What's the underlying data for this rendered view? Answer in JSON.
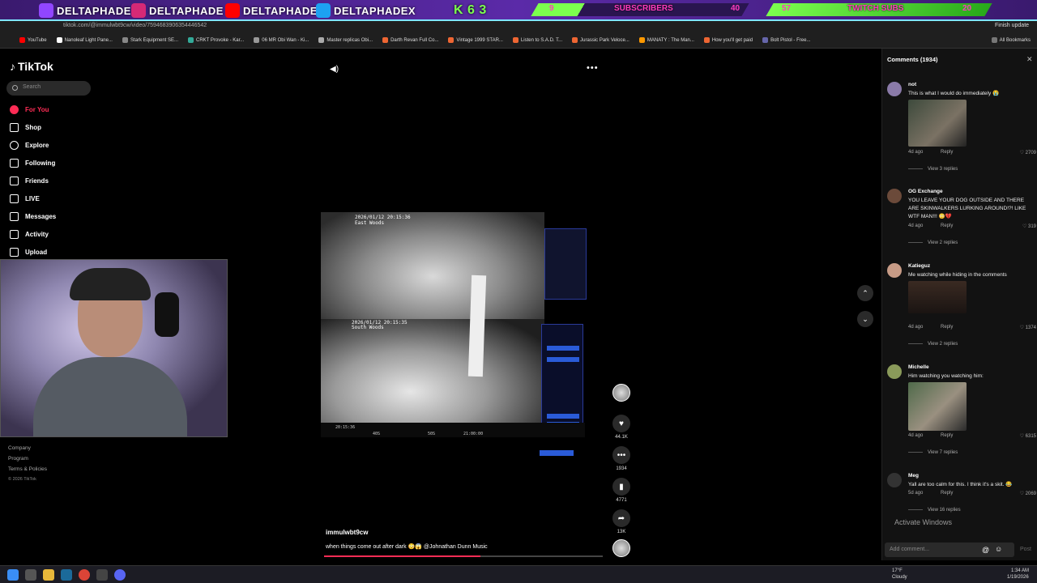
{
  "overlay": {
    "handles": [
      "DELTAPHADE",
      "DELTAPHADE",
      "DELTAPHADE",
      "DELTAPHADEX"
    ],
    "goal_letters": "K 6 3",
    "subs_bar": {
      "current": "9",
      "label": "SUBSCRIBERS",
      "goal": "40"
    },
    "twitch_bar": {
      "current": "57",
      "label": "TWITCH SUBS",
      "goal": "20"
    }
  },
  "browser": {
    "url": "tiktok.com/@immulwbt9cw/video/7594683906354446542",
    "update_label": "Finish update",
    "bookmarks": [
      "YouTube",
      "Nanoleaf Light Pane...",
      "Stark Equipment SE...",
      "CRKT Provoke - Kar...",
      "06 MR Obi Wan - Ki...",
      "Master replicas Obi...",
      "Darth Revan Full Co...",
      "Vintage 1999 STAR...",
      "Listen to S.A.D. T...",
      "Jurassic Park Veloce...",
      "MANATY : The Man...",
      "How you'll get paid",
      "Bolt Pistol - Free..."
    ],
    "all_bookmarks": "All Bookmarks"
  },
  "sidebar": {
    "logo": "TikTok",
    "search_placeholder": "Search",
    "nav": [
      "For You",
      "Shop",
      "Explore",
      "Following",
      "Friends",
      "LIVE",
      "Messages",
      "Activity",
      "Upload"
    ],
    "footer": [
      "Company",
      "Program",
      "Terms & Policies",
      "© 2026 TikTok"
    ]
  },
  "video": {
    "cam1_stamp": "2026/01/12 20:15:36",
    "cam1_name": "East Woods",
    "cam2_stamp": "2026/01/12 20:15:35",
    "cam2_name": "South Woods",
    "timeline": [
      "20:15:36",
      "40S",
      "50S",
      "21:00:00"
    ],
    "author": "immulwbt9cw",
    "caption": "when things come out after dark 😳😱 @Johnathan Dunn Music",
    "progress_fraction": 0.56
  },
  "actions": {
    "likes": "44.1K",
    "comments": "1934",
    "saves": "4771",
    "shares": "13K"
  },
  "comments": {
    "header": "Comments (1934)",
    "items": [
      {
        "user": "not",
        "text": "This is what I would do immediately 😭",
        "age": "4d ago",
        "reply": "Reply",
        "likes": "2709",
        "view_replies": "View 3 replies"
      },
      {
        "user": "OG Exchange",
        "text": "YOU LEAVE YOUR DOG OUTSIDE AND THERE ARE SKINWALKERS LURKING AROUND!?! LIKE WTF MAN!!! 😳💔",
        "age": "4d ago",
        "reply": "Reply",
        "likes": "319",
        "view_replies": "View 2 replies"
      },
      {
        "user": "Katieguz",
        "text": "Me watching while hiding in the comments",
        "age": "4d ago",
        "reply": "Reply",
        "likes": "1374",
        "view_replies": "View 2 replies"
      },
      {
        "user": "Michelle",
        "text": "Him watching you watching him:",
        "age": "4d ago",
        "reply": "Reply",
        "likes": "6315",
        "view_replies": "View 7 replies"
      },
      {
        "user": "Meg",
        "text": "Yall are too calm for this. I think it's a skit. 😂",
        "age": "5d ago",
        "reply": "Reply",
        "likes": "2069",
        "view_replies": "View 16 replies"
      }
    ],
    "add_placeholder": "Add comment...",
    "post_label": "Post",
    "activate_windows": "Activate Windows"
  },
  "taskbar": {
    "weather_temp": "17°F",
    "weather_desc": "Cloudy",
    "time": "1:34 AM",
    "date": "1/19/2026"
  }
}
